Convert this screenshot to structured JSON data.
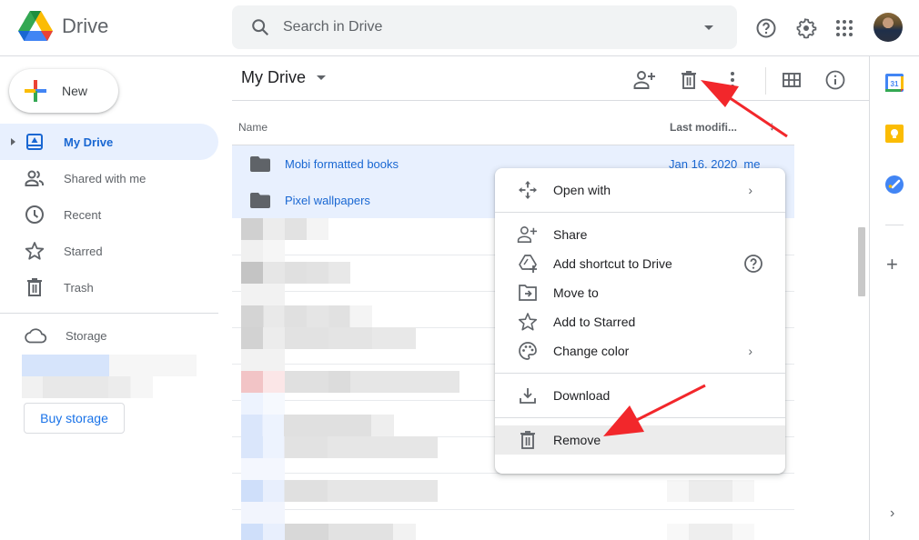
{
  "app": {
    "name": "Drive",
    "logo": "google-drive-logo"
  },
  "search": {
    "placeholder": "Search in Drive",
    "icon": "search-icon",
    "options_icon": "caret-down-icon"
  },
  "header_icons": [
    {
      "name": "help-icon",
      "label": "Support"
    },
    {
      "name": "gear-icon",
      "label": "Settings"
    },
    {
      "name": "apps-grid-icon",
      "label": "Google apps"
    },
    {
      "name": "avatar",
      "label": "Account"
    }
  ],
  "sidebar": {
    "new_label": "New",
    "items": [
      {
        "label": "My Drive",
        "icon": "my-drive-icon",
        "active": true
      },
      {
        "label": "Shared with me",
        "icon": "shared-icon",
        "active": false
      },
      {
        "label": "Recent",
        "icon": "clock-icon",
        "active": false
      },
      {
        "label": "Starred",
        "icon": "star-icon",
        "active": false
      },
      {
        "label": "Trash",
        "icon": "trash-icon",
        "active": false
      }
    ],
    "storage_label": "Storage",
    "buy_storage_label": "Buy storage"
  },
  "main": {
    "title": "My Drive",
    "toolbar": [
      {
        "name": "share-icon",
        "label": "Share"
      },
      {
        "name": "trash-icon",
        "label": "Remove"
      },
      {
        "name": "more-vert-icon",
        "label": "More actions"
      },
      {
        "name": "grid-view-icon",
        "label": "Grid layout"
      },
      {
        "name": "info-icon",
        "label": "View details"
      }
    ],
    "columns": {
      "name": "Name",
      "modified": "Last modifi...",
      "sort_icon": "arrow-down-icon"
    },
    "files": [
      {
        "name": "Mobi formatted books",
        "type": "folder",
        "modified": "Jan 16, 2020",
        "owner": "me",
        "selected": true
      },
      {
        "name": "Pixel wallpapers",
        "type": "folder",
        "modified": "",
        "owner": "",
        "selected": true
      }
    ]
  },
  "context_menu": {
    "groups": [
      [
        {
          "label": "Open with",
          "icon": "open-with-icon",
          "submenu": true
        }
      ],
      [
        {
          "label": "Share",
          "icon": "share-icon"
        },
        {
          "label": "Add shortcut to Drive",
          "icon": "add-shortcut-icon",
          "help": true
        },
        {
          "label": "Move to",
          "icon": "move-to-icon"
        },
        {
          "label": "Add to Starred",
          "icon": "star-icon"
        },
        {
          "label": "Change color",
          "icon": "palette-icon",
          "submenu": true
        }
      ],
      [
        {
          "label": "Download",
          "icon": "download-icon"
        }
      ],
      [
        {
          "label": "Remove",
          "icon": "trash-icon",
          "hovered": true
        }
      ]
    ]
  },
  "right_panel": [
    {
      "name": "calendar-icon",
      "label": "Calendar",
      "text": "31"
    },
    {
      "name": "keep-icon",
      "label": "Keep"
    },
    {
      "name": "tasks-icon",
      "label": "Tasks"
    },
    {
      "name": "add-addon-icon",
      "label": "Get add-ons"
    },
    {
      "name": "expand-panel-icon",
      "label": "Show side panel"
    }
  ],
  "colors": {
    "accent": "#1a73e8",
    "selected_bg": "#e8f0fe",
    "selected_text": "#1967d2",
    "annotation_arrow": "#f2272b"
  }
}
